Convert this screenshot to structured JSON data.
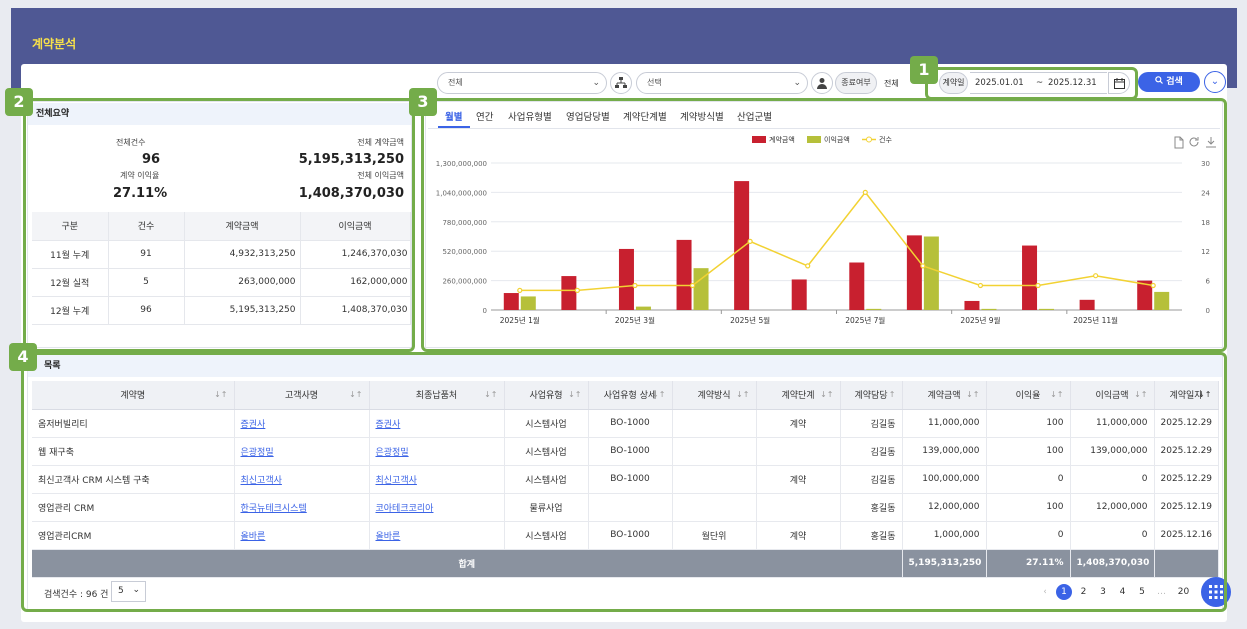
{
  "page_title": "계약분석",
  "filters": {
    "select1": "전체",
    "select2": "선택",
    "end_label": "종료여부",
    "end_value": "전체",
    "date_label": "계약일",
    "date_from": "2025.01.01",
    "date_sep": "~",
    "date_to": "2025.12.31",
    "search_label": "검색"
  },
  "badges": [
    "1",
    "2",
    "3",
    "4"
  ],
  "summary": {
    "title": "전체요약",
    "total_count_label": "전체건수",
    "total_count": "96",
    "total_amount_label": "전체 계약금액",
    "total_amount": "5,195,313,250",
    "margin_label": "계약 이익율",
    "margin": "27.11%",
    "profit_label": "전체 이익금액",
    "profit": "1,408,370,030",
    "columns": [
      "구분",
      "건수",
      "계약금액",
      "이익금액"
    ],
    "rows": [
      [
        "11월 누계",
        "91",
        "4,932,313,250",
        "1,246,370,030"
      ],
      [
        "12월 실적",
        "5",
        "263,000,000",
        "162,000,000"
      ],
      [
        "12월 누계",
        "96",
        "5,195,313,250",
        "1,408,370,030"
      ]
    ]
  },
  "tabs": [
    "월별",
    "연간",
    "사업유형별",
    "영업담당별",
    "계약단계별",
    "계약방식별",
    "산업군별"
  ],
  "chart_data": {
    "type": "bar",
    "categories": [
      "2025년 1월",
      "2025년 2월",
      "2025년 3월",
      "2025년 4월",
      "2025년 5월",
      "2025년 6월",
      "2025년 7월",
      "2025년 8월",
      "2025년 9월",
      "2025년 10월",
      "2025년 11월",
      "2025년 12월"
    ],
    "x_tick_labels": [
      "2025년 1월",
      "2025년 3월",
      "2025년 5월",
      "2025년 7월",
      "2025년 9월",
      "2025년 11월"
    ],
    "series": [
      {
        "name": "계약금액",
        "kind": "bar",
        "axis": "left",
        "color": "#c8202f",
        "values": [
          150000000,
          300000000,
          540000000,
          620000000,
          1140000000,
          270000000,
          420000000,
          660000000,
          80000000,
          570000000,
          90000000,
          260000000
        ]
      },
      {
        "name": "이익금액",
        "kind": "bar",
        "axis": "left",
        "color": "#b6c03a",
        "values": [
          120000000,
          0,
          30000000,
          370000000,
          0,
          0,
          10000000,
          650000000,
          10000000,
          10000000,
          0,
          160000000
        ]
      },
      {
        "name": "건수",
        "kind": "line",
        "axis": "right",
        "color": "#f2d233",
        "values": [
          4,
          4,
          5,
          5,
          14,
          9,
          24,
          9,
          5,
          5,
          7,
          5
        ]
      }
    ],
    "y_left_ticks": [
      "0",
      "260,000,000",
      "520,000,000",
      "780,000,000",
      "1,040,000,000",
      "1,300,000,000"
    ],
    "y_right_ticks": [
      "0",
      "6",
      "12",
      "18",
      "24",
      "30"
    ],
    "ylim": [
      0,
      1300000000
    ],
    "y2lim": [
      0,
      30
    ],
    "grid": true,
    "legend": "top-center"
  },
  "list": {
    "title": "목록",
    "columns": [
      "계약명",
      "고객사명",
      "최종납품처",
      "사업유형",
      "사업유형 상세",
      "계약방식",
      "계약단계",
      "계약담당",
      "계약금액",
      "이익율",
      "이익금액",
      "계약일자"
    ],
    "rows": [
      [
        "옴저버빌리티",
        "증권사",
        "증권사",
        "시스템사업",
        "BO-1000",
        "",
        "계약",
        "김길동",
        "11,000,000",
        "100",
        "11,000,000",
        "2025.12.29"
      ],
      [
        "웹 재구축",
        "은광정밀",
        "은광정밀",
        "시스템사업",
        "BO-1000",
        "",
        "",
        "김길동",
        "139,000,000",
        "100",
        "139,000,000",
        "2025.12.29"
      ],
      [
        "최신고객사 CRM 시스템 구축",
        "최신고객사",
        "최신고객사",
        "시스템사업",
        "BO-1000",
        "",
        "계약",
        "김길동",
        "100,000,000",
        "0",
        "0",
        "2025.12.29"
      ],
      [
        "영업관리 CRM",
        "한국뉴테크시스템",
        "코아테크코리아",
        "물류사업",
        "",
        "",
        "",
        "홍길동",
        "12,000,000",
        "100",
        "12,000,000",
        "2025.12.19"
      ],
      [
        "영업관리CRM",
        "올바른",
        "올바른",
        "시스템사업",
        "BO-1000",
        "월단위",
        "계약",
        "홍길동",
        "1,000,000",
        "0",
        "0",
        "2025.12.16"
      ]
    ],
    "total": {
      "label": "합계",
      "amount": "5,195,313,250",
      "rate": "27.11%",
      "profit": "1,408,370,030"
    },
    "count_text": "검색건수 : 96 건",
    "page_size": "5",
    "pages": [
      "1",
      "2",
      "3",
      "4",
      "5",
      "…",
      "20"
    ],
    "current_page": "1"
  }
}
